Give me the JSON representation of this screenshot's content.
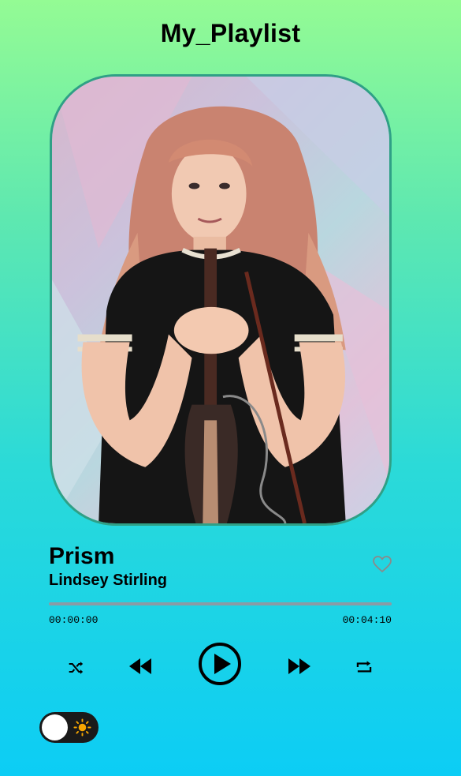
{
  "app": {
    "title": "My_Playlist"
  },
  "track": {
    "title": "Prism",
    "artist": "Lindsey Stirling",
    "current_time": "00:00:00",
    "duration": "00:04:10",
    "progress_fraction": 0,
    "liked": false
  },
  "controls": {
    "shuffle_icon": "shuffle-icon",
    "previous_icon": "rewind-icon",
    "play_icon": "play-circle-icon",
    "next_icon": "fast-forward-icon",
    "repeat_icon": "repeat-icon"
  },
  "theme": {
    "mode": "light",
    "toggle_icon": "sun-icon",
    "accent": "#f7a600"
  },
  "colors": {
    "gradient_top": "#94fb94",
    "gradient_bottom": "#0ccdf5",
    "art_border": "#2fa086",
    "progress_track": "#8a9ba5"
  }
}
